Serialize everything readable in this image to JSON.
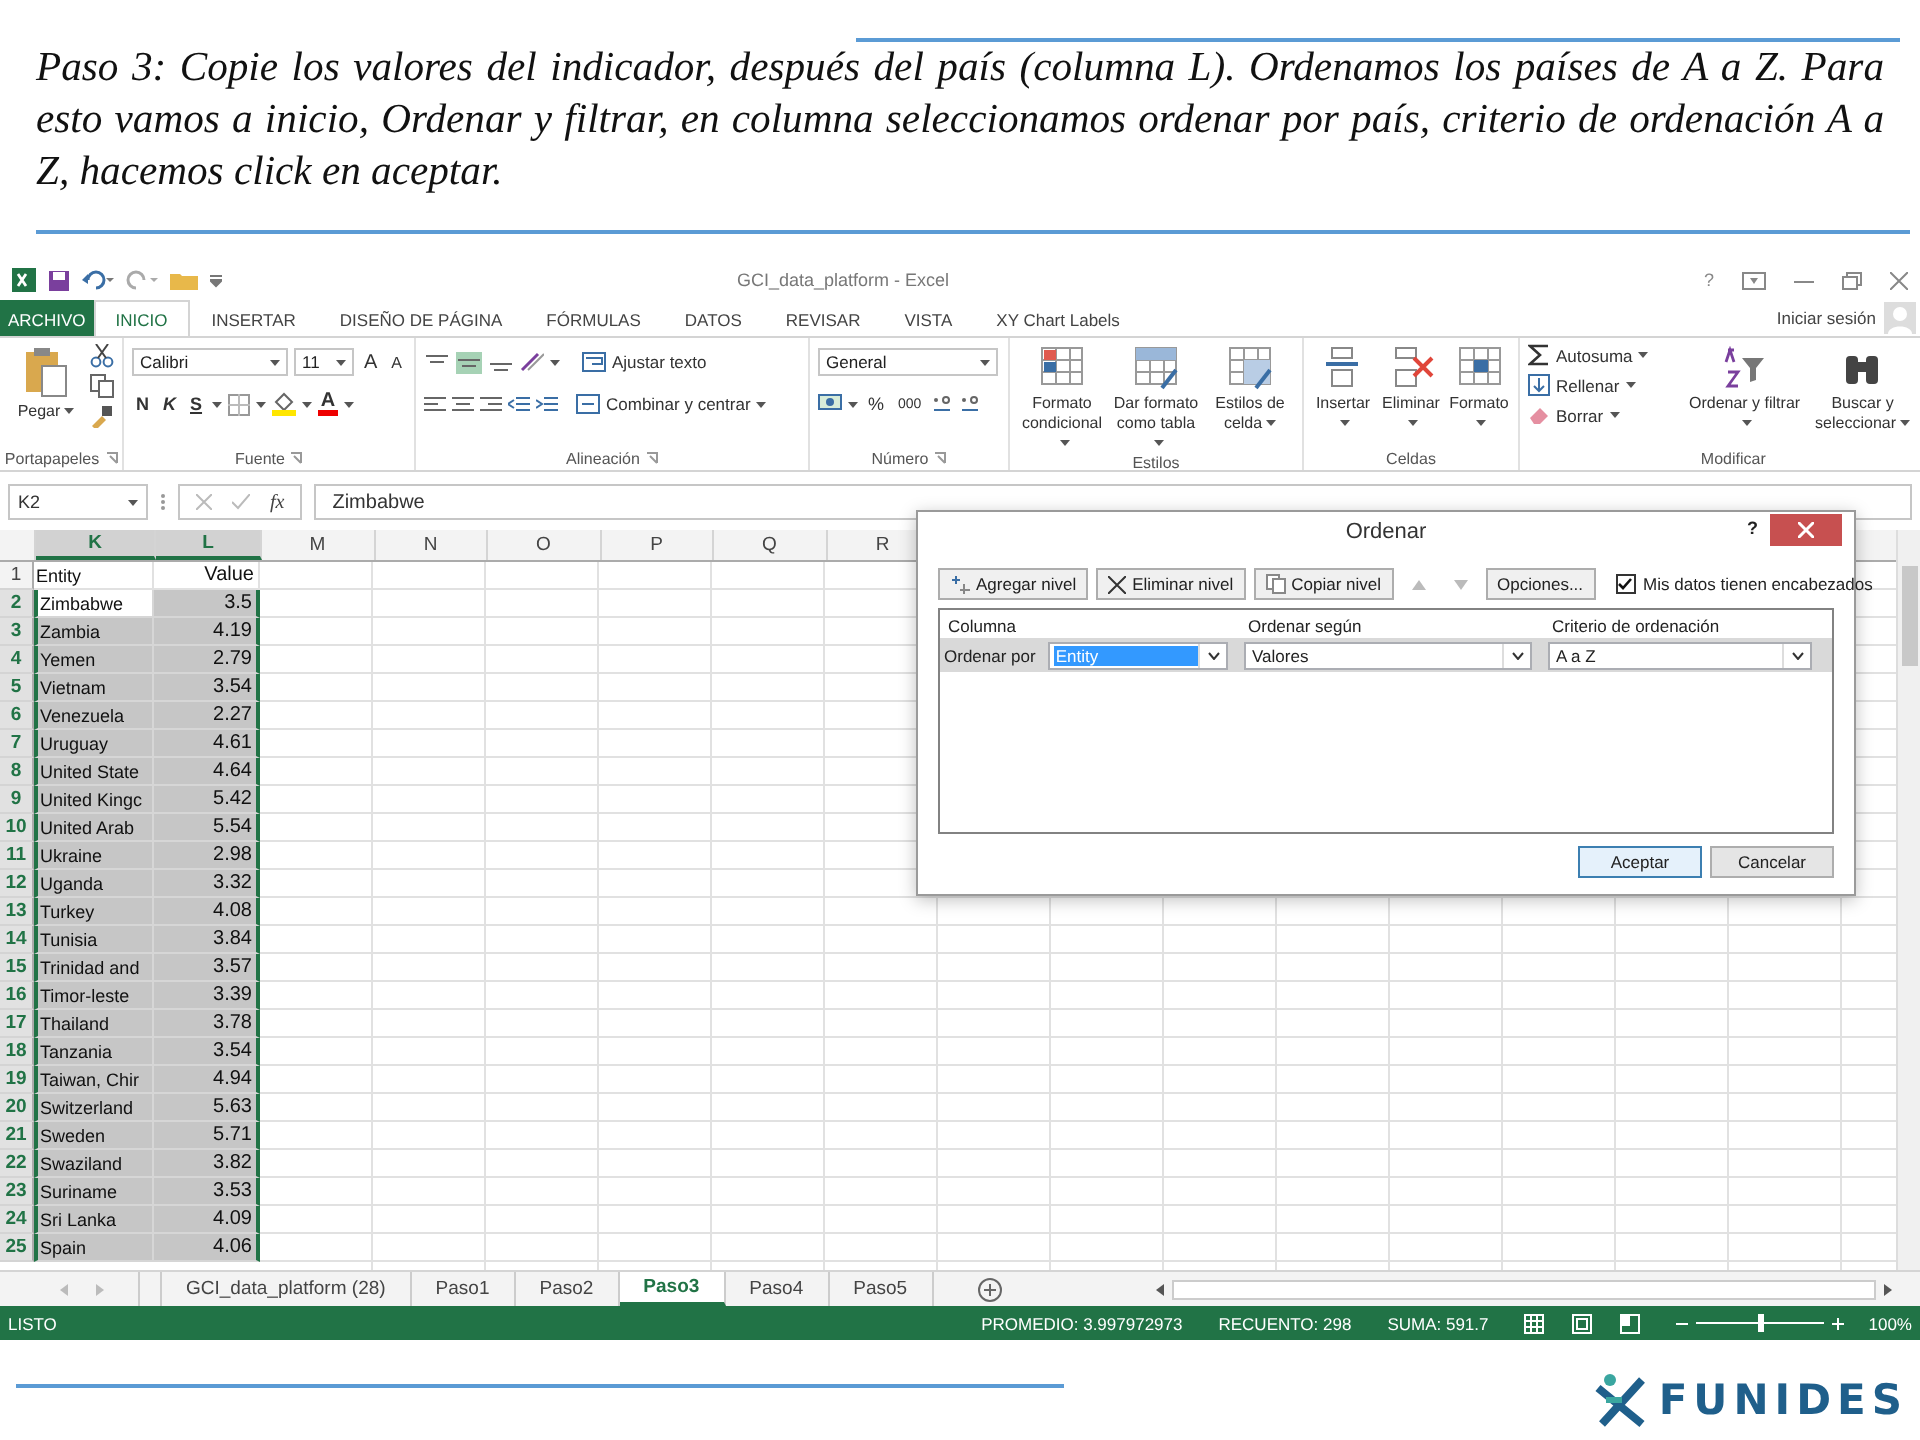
{
  "slide": {
    "caption": "Paso 3: Copie los valores del indicador, después del país (columna L). Ordenamos los países de A a Z. Para esto vamos a inicio, Ordenar y filtrar, en columna  seleccionamos ordenar por país, criterio de ordenación A a Z, hacemos click en aceptar.",
    "logo": "FUNIDES"
  },
  "excel": {
    "title": "GCI_data_platform - Excel",
    "help": "?",
    "ribbon_tabs": [
      {
        "label": "ARCHIVO",
        "kind": "file",
        "selected": false
      },
      {
        "label": "INICIO",
        "kind": "tab",
        "selected": true
      },
      {
        "label": "INSERTAR",
        "kind": "tab",
        "selected": false
      },
      {
        "label": "DISEÑO DE PÁGINA",
        "kind": "tab",
        "selected": false
      },
      {
        "label": "FÓRMULAS",
        "kind": "tab",
        "selected": false
      },
      {
        "label": "DATOS",
        "kind": "tab",
        "selected": false
      },
      {
        "label": "REVISAR",
        "kind": "tab",
        "selected": false
      },
      {
        "label": "VISTA",
        "kind": "tab",
        "selected": false
      },
      {
        "label": "XY Chart Labels",
        "kind": "tab",
        "selected": false
      }
    ],
    "account": "Iniciar sesión",
    "ribbon": {
      "clipboard": {
        "paste": "Pegar",
        "group": "Portapapeles"
      },
      "font": {
        "name": "Calibri",
        "size": "11",
        "grow": "A",
        "shrink": "A",
        "bold": "N",
        "italic": "K",
        "underline": "S",
        "color_letter": "A",
        "group": "Fuente"
      },
      "alignment": {
        "vertical": [
          {
            "selected": false
          },
          {
            "selected": true
          },
          {
            "selected": false
          }
        ],
        "wrap": "Ajustar texto",
        "merge": "Combinar y centrar",
        "group": "Alineación"
      },
      "number": {
        "format": "General",
        "percent": "%",
        "thousands": "000",
        "group": "Número"
      },
      "styles": {
        "conditional": "Formato condicional",
        "table": "Dar formato como tabla",
        "cell": "Estilos de celda",
        "group": "Estilos"
      },
      "cells": {
        "insert": "Insertar",
        "delete": "Eliminar",
        "format": "Formato",
        "group": "Celdas"
      },
      "editing": {
        "autosum": "Autosuma",
        "fill": "Rellenar",
        "clear": "Borrar",
        "sort": "Ordenar y filtrar",
        "find": "Buscar y seleccionar",
        "group": "Modificar"
      }
    },
    "name_box": "K2",
    "fx": "fx",
    "formula": "Zimbabwe",
    "columns": [
      {
        "label": "K",
        "selected": true
      },
      {
        "label": "L",
        "selected": true
      },
      {
        "label": "M",
        "selected": false
      },
      {
        "label": "N",
        "selected": false
      },
      {
        "label": "O",
        "selected": false
      },
      {
        "label": "P",
        "selected": false
      },
      {
        "label": "Q",
        "selected": false
      },
      {
        "label": "R",
        "selected": false
      }
    ],
    "rows": [
      {
        "n": "1",
        "k": "Entity",
        "l": "Value",
        "selected": false,
        "active": false
      },
      {
        "n": "2",
        "k": "Zimbabwe",
        "l": "3.5",
        "selected": true,
        "active": true
      },
      {
        "n": "3",
        "k": "Zambia",
        "l": "4.19",
        "selected": true,
        "active": false
      },
      {
        "n": "4",
        "k": "Yemen",
        "l": "2.79",
        "selected": true,
        "active": false
      },
      {
        "n": "5",
        "k": "Vietnam",
        "l": "3.54",
        "selected": true,
        "active": false
      },
      {
        "n": "6",
        "k": "Venezuela",
        "l": "2.27",
        "selected": true,
        "active": false
      },
      {
        "n": "7",
        "k": "Uruguay",
        "l": "4.61",
        "selected": true,
        "active": false
      },
      {
        "n": "8",
        "k": "United State",
        "l": "4.64",
        "selected": true,
        "active": false
      },
      {
        "n": "9",
        "k": "United Kingc",
        "l": "5.42",
        "selected": true,
        "active": false
      },
      {
        "n": "10",
        "k": "United Arab",
        "l": "5.54",
        "selected": true,
        "active": false
      },
      {
        "n": "11",
        "k": "Ukraine",
        "l": "2.98",
        "selected": true,
        "active": false
      },
      {
        "n": "12",
        "k": "Uganda",
        "l": "3.32",
        "selected": true,
        "active": false
      },
      {
        "n": "13",
        "k": "Turkey",
        "l": "4.08",
        "selected": true,
        "active": false
      },
      {
        "n": "14",
        "k": "Tunisia",
        "l": "3.84",
        "selected": true,
        "active": false
      },
      {
        "n": "15",
        "k": "Trinidad and",
        "l": "3.57",
        "selected": true,
        "active": false
      },
      {
        "n": "16",
        "k": "Timor-leste",
        "l": "3.39",
        "selected": true,
        "active": false
      },
      {
        "n": "17",
        "k": "Thailand",
        "l": "3.78",
        "selected": true,
        "active": false
      },
      {
        "n": "18",
        "k": "Tanzania",
        "l": "3.54",
        "selected": true,
        "active": false
      },
      {
        "n": "19",
        "k": "Taiwan, Chir",
        "l": "4.94",
        "selected": true,
        "active": false
      },
      {
        "n": "20",
        "k": "Switzerland",
        "l": "5.63",
        "selected": true,
        "active": false
      },
      {
        "n": "21",
        "k": "Sweden",
        "l": "5.71",
        "selected": true,
        "active": false
      },
      {
        "n": "22",
        "k": "Swaziland",
        "l": "3.82",
        "selected": true,
        "active": false
      },
      {
        "n": "23",
        "k": "Suriname",
        "l": "3.53",
        "selected": true,
        "active": false
      },
      {
        "n": "24",
        "k": "Sri Lanka",
        "l": "4.09",
        "selected": true,
        "active": false
      },
      {
        "n": "25",
        "k": "Spain",
        "l": "4.06",
        "selected": true,
        "active": false
      }
    ],
    "sheet_tabs": [
      {
        "label": "GCI_data_platform (28)",
        "selected": false
      },
      {
        "label": "Paso1",
        "selected": false
      },
      {
        "label": "Paso2",
        "selected": false
      },
      {
        "label": "Paso3",
        "selected": true
      },
      {
        "label": "Paso4",
        "selected": false
      },
      {
        "label": "Paso5",
        "selected": false
      }
    ],
    "status": {
      "mode": "LISTO",
      "stats": [
        "PROMEDIO: 3.997972973",
        "RECUENTO: 298",
        "SUMA: 591.7"
      ],
      "zoom": {
        "level": 0.5,
        "reading": "100%"
      }
    },
    "dialog": {
      "title": "Ordenar",
      "help": "?",
      "toolbar": [
        "Agregar nivel",
        "Eliminar nivel",
        "Copiar nivel"
      ],
      "move_buttons": [
        {
          "disabled": true
        },
        {
          "disabled": true
        }
      ],
      "options": "Opciones...",
      "has_headers": {
        "label": "Mis datos tienen encabezados",
        "checked": true
      },
      "headers": [
        "Columna",
        "Ordenar según",
        "Criterio de ordenación"
      ],
      "row_label": "Ordenar por",
      "combos": [
        {
          "value": "Entity",
          "highlighted": true
        },
        {
          "value": "Valores",
          "highlighted": false
        },
        {
          "value": "A a Z",
          "highlighted": false
        }
      ],
      "buttons": [
        {
          "label": "Aceptar",
          "default": true
        },
        {
          "label": "Cancelar",
          "default": false
        }
      ]
    }
  }
}
